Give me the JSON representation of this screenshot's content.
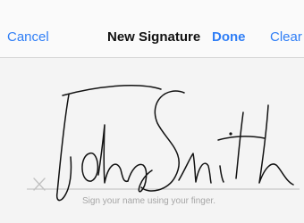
{
  "nav": {
    "cancel_label": "Cancel",
    "title": "New Signature",
    "done_label": "Done",
    "clear_label": "Clear"
  },
  "signature_pad": {
    "hint_text": "Sign your name using your finger.",
    "clear_mark_icon": "x-mark-icon"
  },
  "colors": {
    "accent": "#2f7ef6",
    "ink": "#111111",
    "baseline": "#bdbdbd"
  }
}
